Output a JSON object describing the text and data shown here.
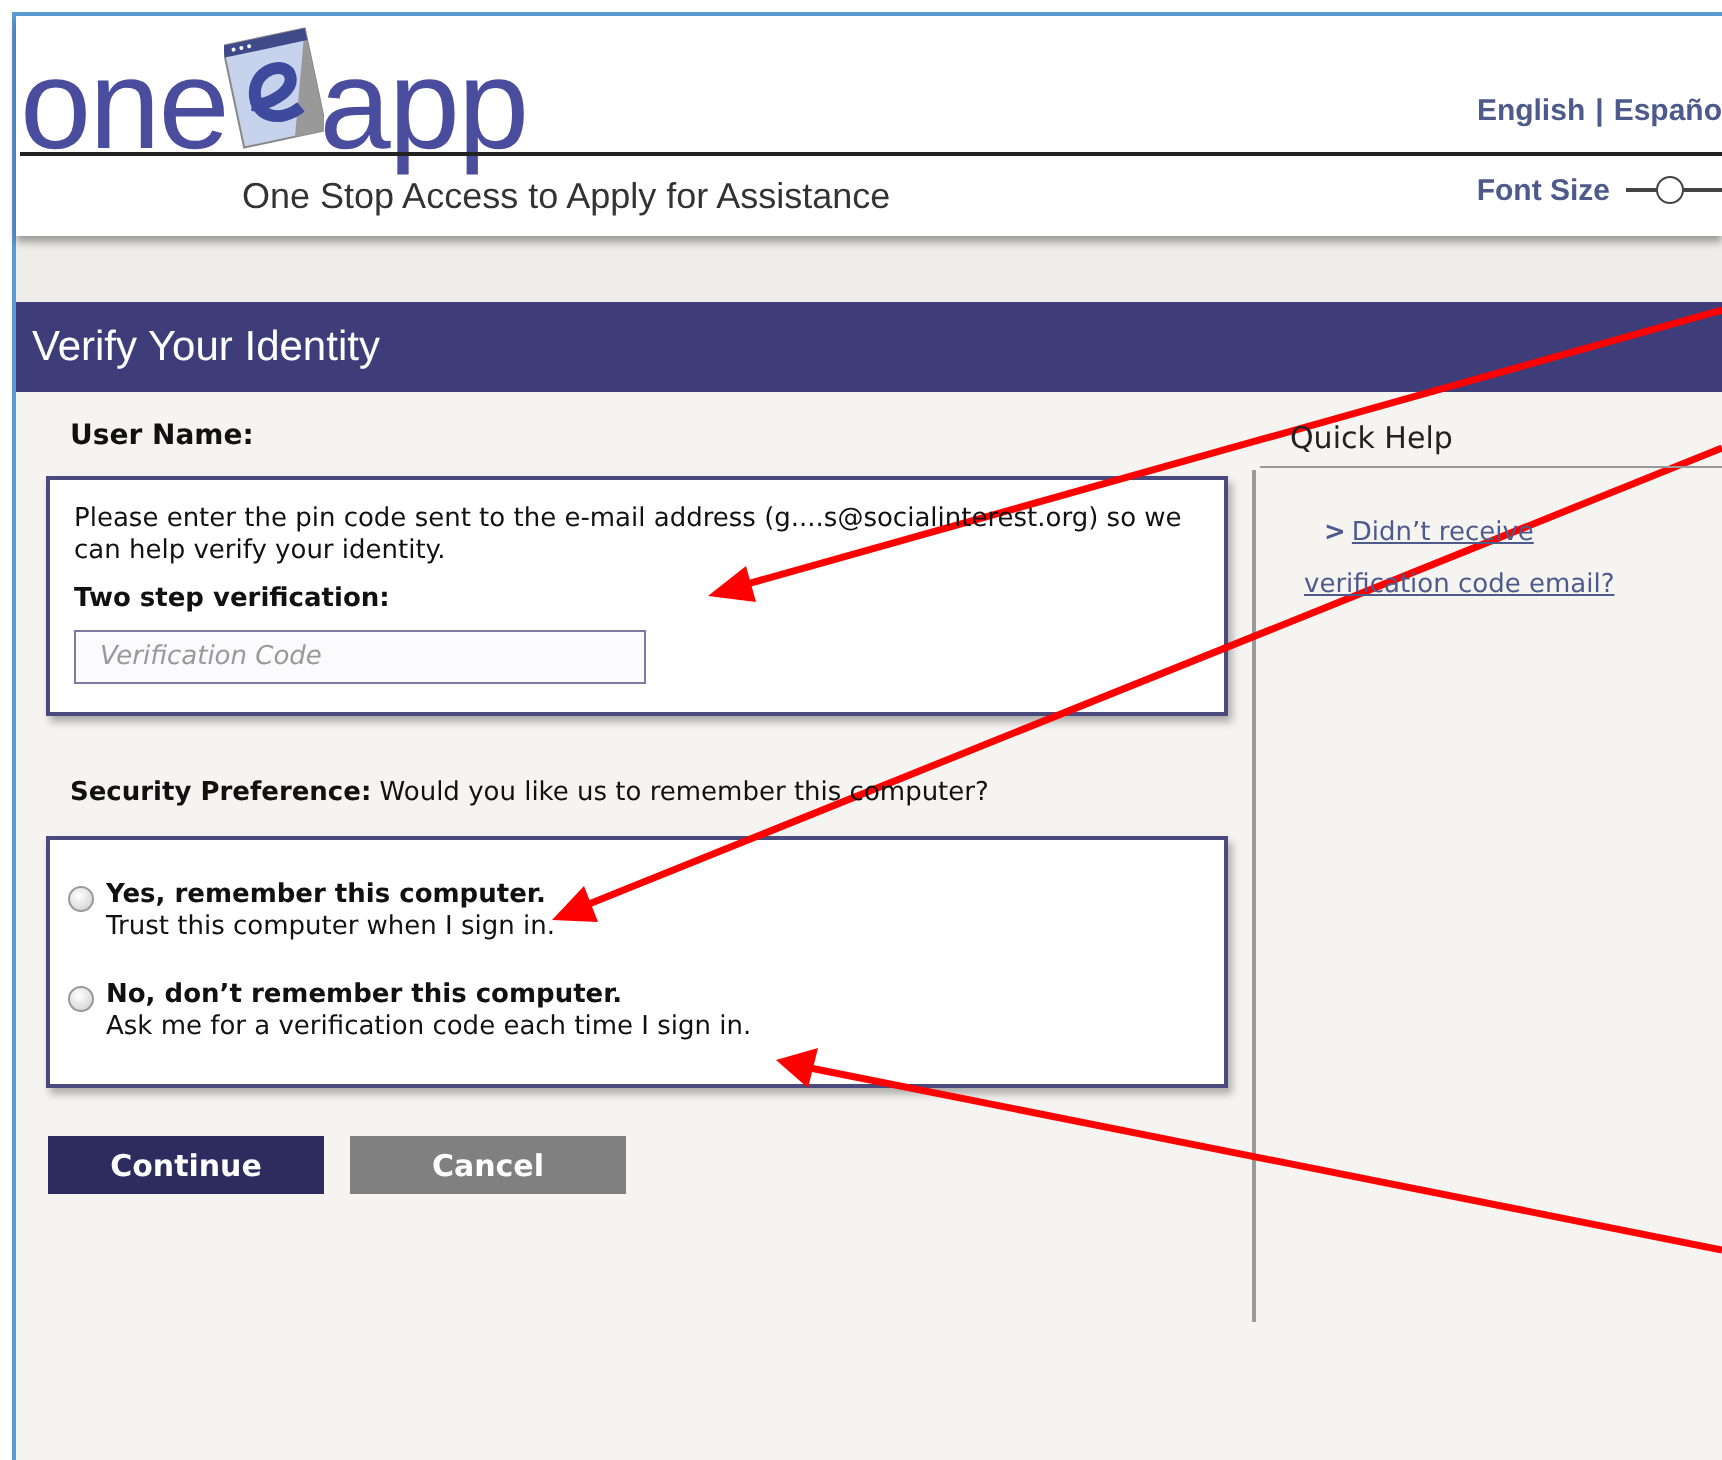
{
  "header": {
    "logo": {
      "left": "one",
      "right": "app"
    },
    "tagline": "One Stop Access to Apply for Assistance",
    "languages": [
      {
        "label": "English"
      },
      {
        "label": "Españo"
      }
    ],
    "separator": "|",
    "font_size": {
      "label": "Font Size",
      "level": 0.45
    }
  },
  "page_title": "Verify Your Identity",
  "form": {
    "user_name_label": "User Name:",
    "instructions": "Please enter the pin code sent to the e-mail address (g....s@socialinterest.org) so we can help verify your identity.",
    "verification_label": "Two step verification:",
    "verification_field": {
      "placeholder": "Verification Code"
    },
    "security_question": "**Security Preference:** Would you like us to remember this computer?",
    "options": [
      {
        "title": "Yes, remember this computer.",
        "description": "Trust this computer when I sign in.",
        "selected": false
      },
      {
        "title": "No, don’t remember this computer.",
        "description": "Ask me for a verification code each time I sign in.",
        "selected": false
      }
    ],
    "buttons": [
      {
        "label": "Continue",
        "kind": "primary"
      },
      {
        "label": "Cancel",
        "kind": "secondary"
      }
    ]
  },
  "quick_help": {
    "title": "Quick Help",
    "links": [
      {
        "marker": ">",
        "text": "Didn’t receive verification code email?"
      }
    ]
  }
}
